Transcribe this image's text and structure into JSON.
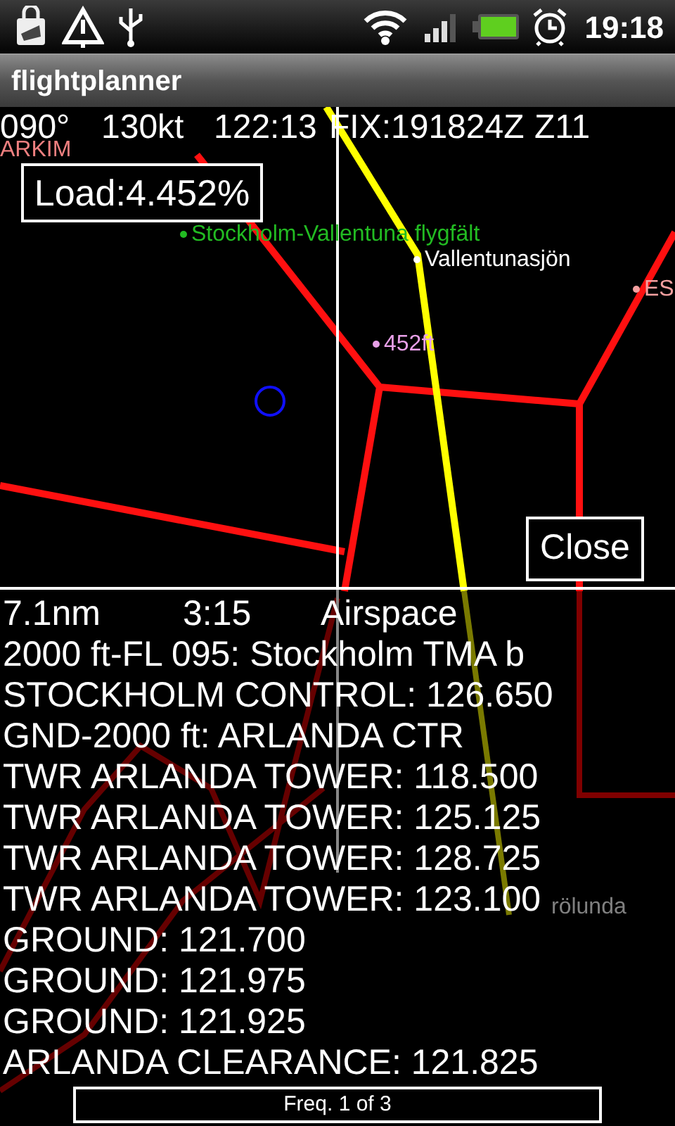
{
  "status_bar": {
    "time": "19:18"
  },
  "app_title": "flightplanner",
  "nav_line": [
    "090°",
    "130kt",
    "122:13",
    "FIX:191824Z",
    "Z11"
  ],
  "map_labels": [
    {
      "text": "ARKIM",
      "color": "#f08080",
      "dot": false
    },
    {
      "text": "Stockholm-Vallentuna flygfält",
      "color": "#22bb22",
      "dot": true
    },
    {
      "text": "Vallentunasjön",
      "color": "#ffffff",
      "dot": true
    },
    {
      "text": "ES",
      "color": "#f4a0a0",
      "dot": true
    },
    {
      "text": "452ft",
      "color": "#e8a0e8",
      "dot": true
    },
    {
      "text": "rölunda",
      "color": "#808080",
      "dot": false
    }
  ],
  "load_box": "Load:4.452%",
  "close_button": "Close",
  "info": {
    "summary": [
      "7.1nm",
      "3:15",
      "Airspace"
    ],
    "lines": [
      "2000 ft-FL 095: Stockholm TMA b",
      "STOCKHOLM CONTROL: 126.650",
      "GND-2000 ft: ARLANDA CTR",
      "TWR ARLANDA TOWER: 118.500",
      "TWR ARLANDA TOWER: 125.125",
      "TWR ARLANDA TOWER: 128.725",
      "TWR ARLANDA TOWER: 123.100",
      "GROUND: 121.700",
      "GROUND: 121.975",
      "GROUND: 121.925",
      "ARLANDA CLEARANCE: 121.825"
    ]
  },
  "pager": "Freq. 1 of 3"
}
